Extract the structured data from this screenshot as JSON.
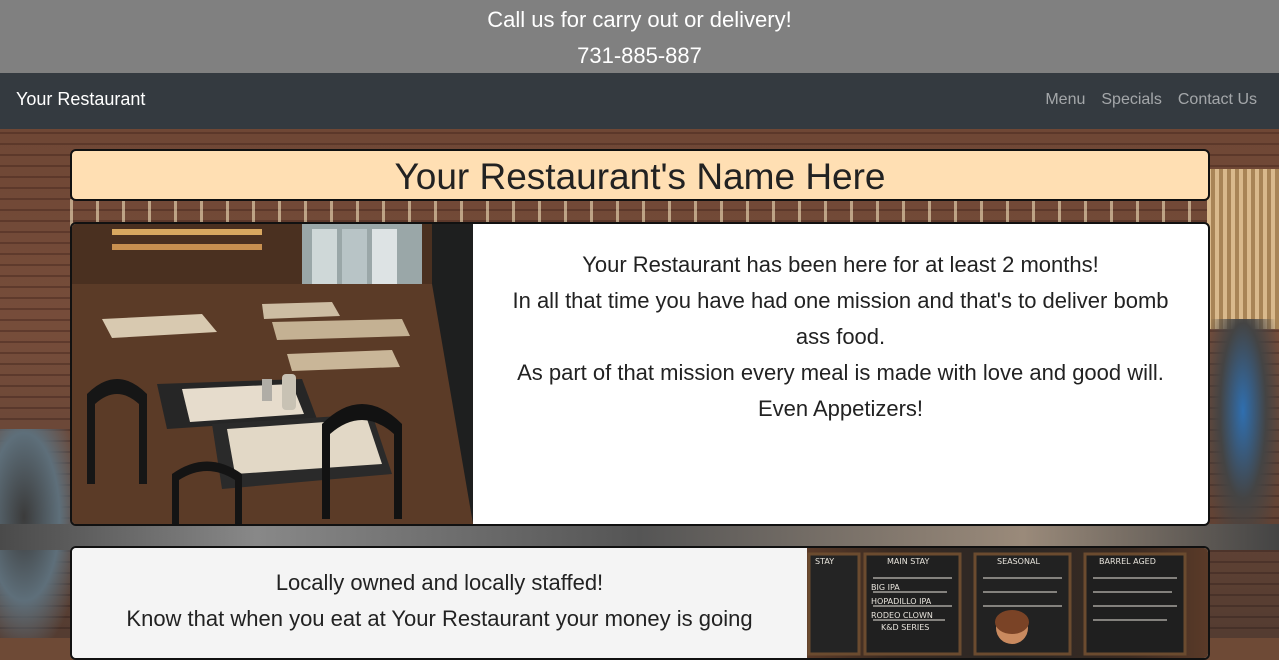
{
  "topbar": {
    "line1": "Call us for carry out or delivery!",
    "line2": "731-885-887"
  },
  "navbar": {
    "brand": "Your Restaurant",
    "links": [
      "Menu",
      "Specials",
      "Contact Us"
    ]
  },
  "title": "Your Restaurant's Name Here",
  "card1": {
    "lines": [
      "Your Restaurant has been here for at least 2 months!",
      "In all that time you have had one mission and that's to deliver bomb ass food.",
      "As part of that mission every meal is made with love and good will.",
      "Even Appetizers!"
    ]
  },
  "card2": {
    "lines": [
      "Locally owned and locally staffed!",
      "Know that when you eat at Your Restaurant your money is going"
    ],
    "board_labels": [
      "STAY",
      "MAIN STAY",
      "SEASONAL",
      "BARREL AGED",
      "BIG IPA",
      "HOPADILLO IPA",
      "RODEO CLOWN",
      "K&D SERIES"
    ]
  }
}
